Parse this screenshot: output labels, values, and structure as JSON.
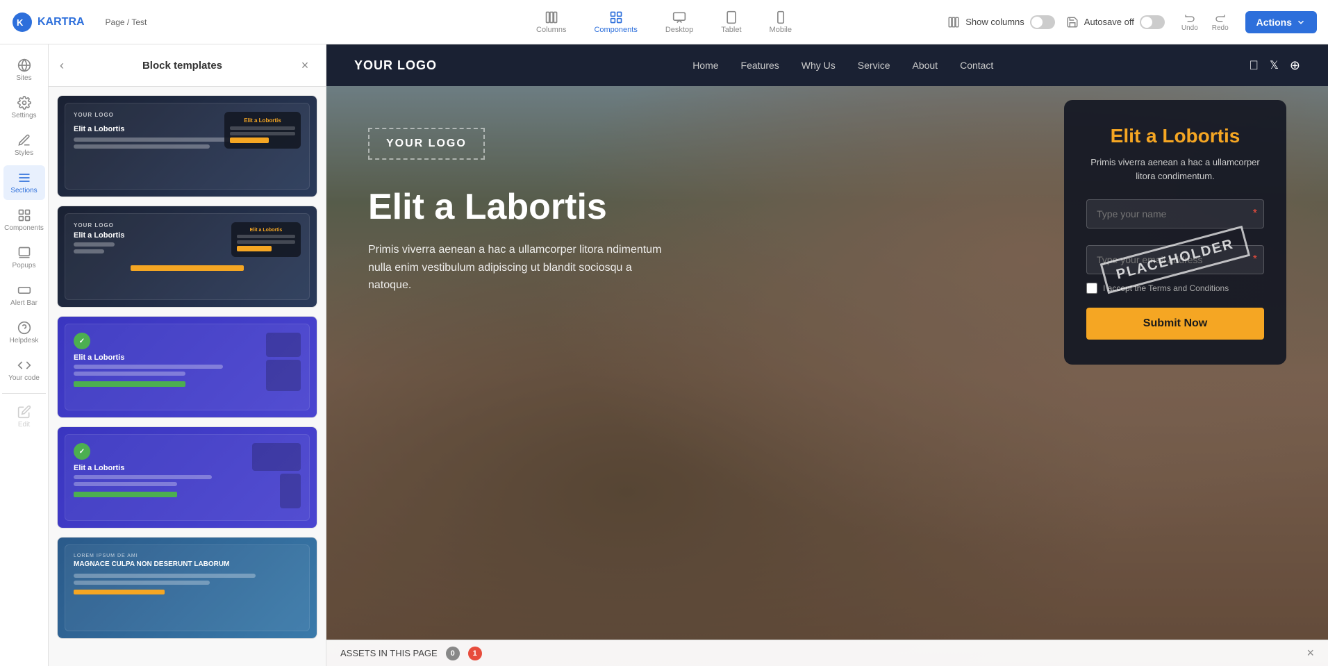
{
  "toolbar": {
    "logo_text": "KARTRA",
    "breadcrumb": "Page / Test",
    "views": [
      {
        "id": "columns",
        "label": "Columns",
        "active": false
      },
      {
        "id": "components",
        "label": "Components",
        "active": true
      },
      {
        "id": "desktop",
        "label": "Desktop",
        "active": false
      },
      {
        "id": "tablet",
        "label": "Tablet",
        "active": false
      },
      {
        "id": "mobile",
        "label": "Mobile",
        "active": false
      }
    ],
    "show_columns_label": "Show columns",
    "autosave_label": "Autosave off",
    "undo_label": "Undo",
    "redo_label": "Redo",
    "actions_label": "Actions"
  },
  "sidebar": {
    "items": [
      {
        "id": "sites",
        "label": "Sites"
      },
      {
        "id": "settings",
        "label": "Settings"
      },
      {
        "id": "styles",
        "label": "Styles"
      },
      {
        "id": "sections",
        "label": "Sections",
        "active": true
      },
      {
        "id": "components",
        "label": "Components"
      },
      {
        "id": "popups",
        "label": "Popups"
      },
      {
        "id": "alert-bar",
        "label": "Alert Bar"
      },
      {
        "id": "helpdesk",
        "label": "Helpdesk"
      },
      {
        "id": "your-code",
        "label": "Your code"
      },
      {
        "id": "edit",
        "label": "Edit",
        "disabled": true
      }
    ]
  },
  "block_templates": {
    "title": "Block templates",
    "templates": [
      {
        "id": "t1",
        "type": "dark-hero"
      },
      {
        "id": "t2",
        "type": "dark-hero-form"
      },
      {
        "id": "t3",
        "type": "blue-devices"
      },
      {
        "id": "t4",
        "type": "blue-devices-2"
      },
      {
        "id": "t5",
        "type": "mountain"
      }
    ]
  },
  "preview": {
    "nav": {
      "logo": "YOUR LOGO",
      "links": [
        "Home",
        "Features",
        "Why Us",
        "Service",
        "About",
        "Contact"
      ]
    },
    "hero": {
      "logo_placeholder": "YOUR LOGO",
      "title": "Elit a Labortis",
      "subtitle": "Primis viverra aenean a hac a ullamcorper litora ndimentum nulla enim vestibulum adipiscing ut blandit sociosqu a natoque."
    },
    "form": {
      "title": "Elit a Lobortis",
      "subtitle": "Primis viverra aenean a hac a ullamcorper litora condimentum.",
      "name_placeholder": "Type your name",
      "email_placeholder": "Type your email address",
      "checkbox_label": "I accept the Terms and Conditions",
      "submit_label": "Submit Now",
      "placeholder_stamp": "PLACEHOLDER"
    }
  },
  "assets_bar": {
    "label": "ASSETS IN THIS PAGE",
    "count_gray": "0",
    "count_red": "1"
  }
}
